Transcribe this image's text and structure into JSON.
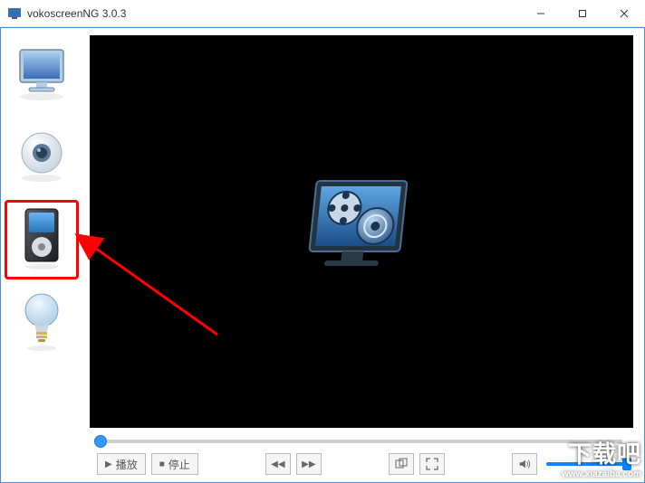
{
  "window": {
    "title": "vokoscreenNG 3.0.3"
  },
  "sidebar": {
    "items": [
      {
        "name": "screen-tab",
        "selected": false
      },
      {
        "name": "webcam-tab",
        "selected": false
      },
      {
        "name": "player-tab",
        "selected": true
      },
      {
        "name": "misc-tab",
        "selected": false
      }
    ]
  },
  "controls": {
    "play_label": "播放",
    "stop_label": "停止"
  },
  "watermark": {
    "title": "下载吧",
    "url": "www.xiazaiba.com"
  }
}
